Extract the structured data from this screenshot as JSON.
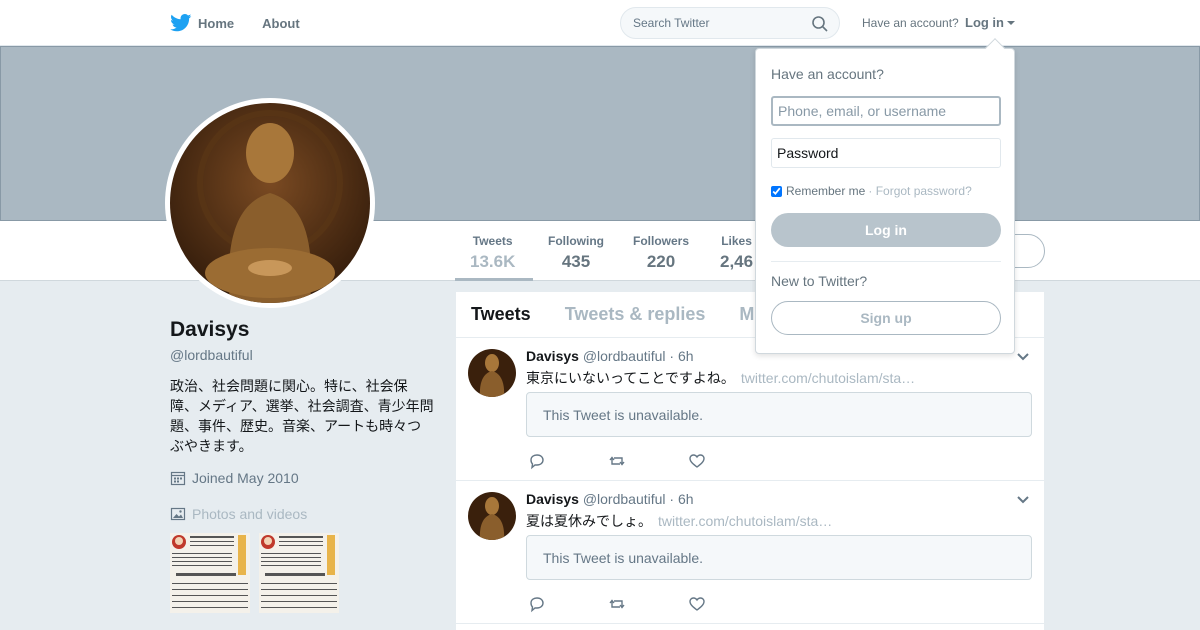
{
  "colors": {
    "brand": "#1da1f2",
    "muted": "#aab8c2",
    "text": "#14171a"
  },
  "nav": {
    "home_label": "Home",
    "about_label": "About",
    "search_placeholder": "Search Twitter",
    "have_account": "Have an account?",
    "login_label": "Log in"
  },
  "profile": {
    "name": "Davisys",
    "handle": "@lordbautiful",
    "bio": "政治、社会問題に関心。特に、社会保障、メディア、選挙、社会調査、青少年問題、事件、歴史。音楽、アートも時々つぶやきます。",
    "joined": "Joined May 2010",
    "photos_label": "Photos and videos"
  },
  "stats": [
    {
      "label": "Tweets",
      "value": "13.6K"
    },
    {
      "label": "Following",
      "value": "435"
    },
    {
      "label": "Followers",
      "value": "220"
    },
    {
      "label": "Likes",
      "value": "2,46"
    }
  ],
  "tabs": [
    {
      "label": "Tweets"
    },
    {
      "label": "Tweets & replies"
    },
    {
      "label": "M"
    }
  ],
  "tweets": [
    {
      "name": "Davisys",
      "handle": "@lordbautiful",
      "time": "· 6h",
      "text": "東京にいないってことですよね。",
      "link": "twitter.com/chutoislam/sta…",
      "unavailable": "This Tweet is unavailable."
    },
    {
      "name": "Davisys",
      "handle": "@lordbautiful",
      "time": "· 6h",
      "text": "夏は夏休みでしょ。",
      "link": "twitter.com/chutoislam/sta…",
      "unavailable": "This Tweet is unavailable."
    }
  ],
  "login_dropdown": {
    "title": "Have an account?",
    "username_placeholder": "Phone, email, or username",
    "password_placeholder": "Password",
    "remember_label": "Remember me",
    "forgot_label": "· Forgot password?",
    "login_button": "Log in",
    "new_label": "New to Twitter?",
    "signup_button": "Sign up"
  }
}
